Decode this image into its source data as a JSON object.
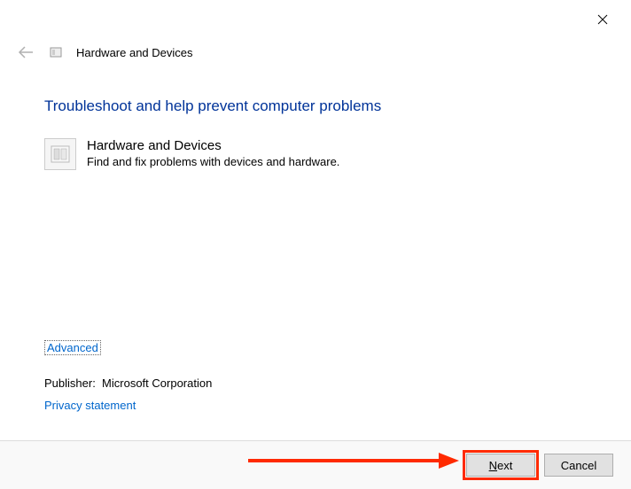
{
  "window": {
    "header_title": "Hardware and Devices"
  },
  "main": {
    "heading": "Troubleshoot and help prevent computer problems",
    "item_title": "Hardware and Devices",
    "item_desc": "Find and fix problems with devices and hardware."
  },
  "links": {
    "advanced": "Advanced",
    "privacy": "Privacy statement"
  },
  "publisher": {
    "label": "Publisher:",
    "name": "Microsoft Corporation"
  },
  "buttons": {
    "next": "Next",
    "cancel": "Cancel"
  }
}
